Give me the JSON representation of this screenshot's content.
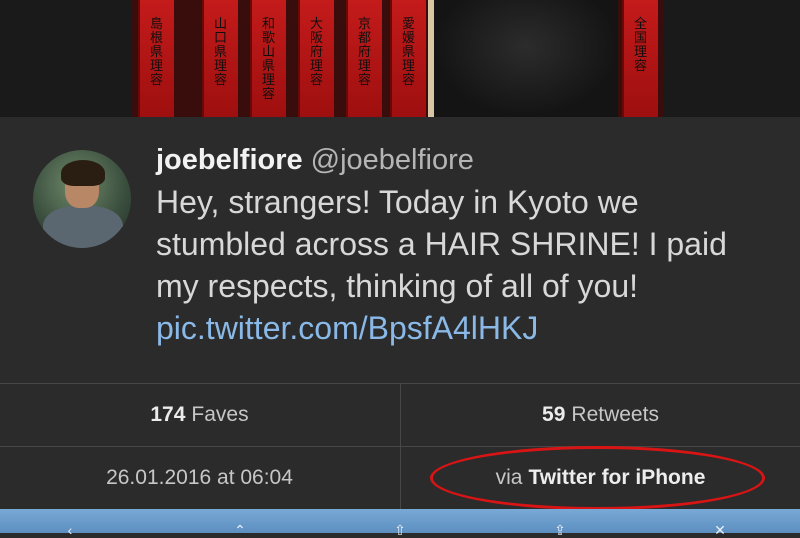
{
  "photo": {
    "plaques": [
      {
        "glyphs": "島根県理容"
      },
      {
        "glyphs": "山口県理容"
      },
      {
        "glyphs": "和歌山県理容"
      },
      {
        "glyphs": "大阪府理容"
      },
      {
        "glyphs": "京都府理容"
      },
      {
        "glyphs": "愛媛県理容"
      },
      {
        "glyphs": "全国理容"
      }
    ]
  },
  "tweet": {
    "display_name": "joebelfiore",
    "handle": "@joebelfiore",
    "text": "Hey, strangers! Today in Kyoto we stumbled across a HAIR SHRINE! I paid my respects, thinking of all of you! ",
    "link": "pic.twitter.com/BpsfA4lHKJ"
  },
  "stats": {
    "faves_count": "174",
    "faves_label": "Faves",
    "retweets_count": "59",
    "retweets_label": "Retweets",
    "timestamp": "26.01.2016 at 06:04",
    "via_prefix": "via",
    "via_client": "Twitter for iPhone"
  },
  "colors": {
    "background": "#2b2b2b",
    "link": "#8ab9e8",
    "highlight": "#d81414",
    "toolbar": "#6a9bcb"
  },
  "toolbar": {
    "icons": [
      "back-icon",
      "reply-icon",
      "retweet-icon",
      "share-icon",
      "more-icon"
    ]
  }
}
